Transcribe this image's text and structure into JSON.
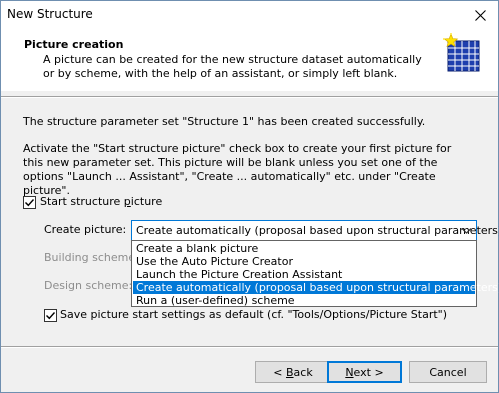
{
  "window": {
    "title": "New Structure"
  },
  "header": {
    "title": "Picture creation",
    "description": "A picture can be created for the new structure dataset automatically or by scheme, with the help of an assistant, or simply left blank."
  },
  "messages": {
    "success": "The structure parameter set \"Structure 1\" has been created successfully.",
    "instructions": "Activate the \"Start structure picture\" check box to create your first picture for this new parameter set. This picture will be blank unless you set one of the options \"Launch ... Assistant\", \"Create ... automatically\" etc. under \"Create picture\"."
  },
  "start_picture": {
    "label_pre": "Start structure ",
    "label_mnemonic": "p",
    "label_post": "icture",
    "checked": true
  },
  "form": {
    "create_picture_label": "Create picture:",
    "building_scheme_label": "Building scheme:",
    "design_scheme_label": "Design scheme:",
    "create_picture_value": "Create automatically (proposal based upon structural parameters)",
    "options": [
      "Create a blank picture",
      "Use the Auto Picture Creator",
      "Launch the Picture Creation Assistant",
      "Create automatically (proposal based upon structural parameters)",
      "Run a (user-defined) scheme"
    ],
    "selected_index": 3
  },
  "save_defaults": {
    "label": "Save picture start settings as default (cf. \"Tools/Options/Picture Start\")",
    "checked": true
  },
  "buttons": {
    "back": {
      "pre": "< ",
      "mnemonic": "B",
      "post": "ack"
    },
    "next": {
      "pre": "",
      "mnemonic": "N",
      "post": "ext >"
    },
    "cancel": "Cancel"
  },
  "colors": {
    "accent": "#0078d7",
    "icon_blue": "#1e3fae",
    "star_yellow": "#ffe100"
  }
}
